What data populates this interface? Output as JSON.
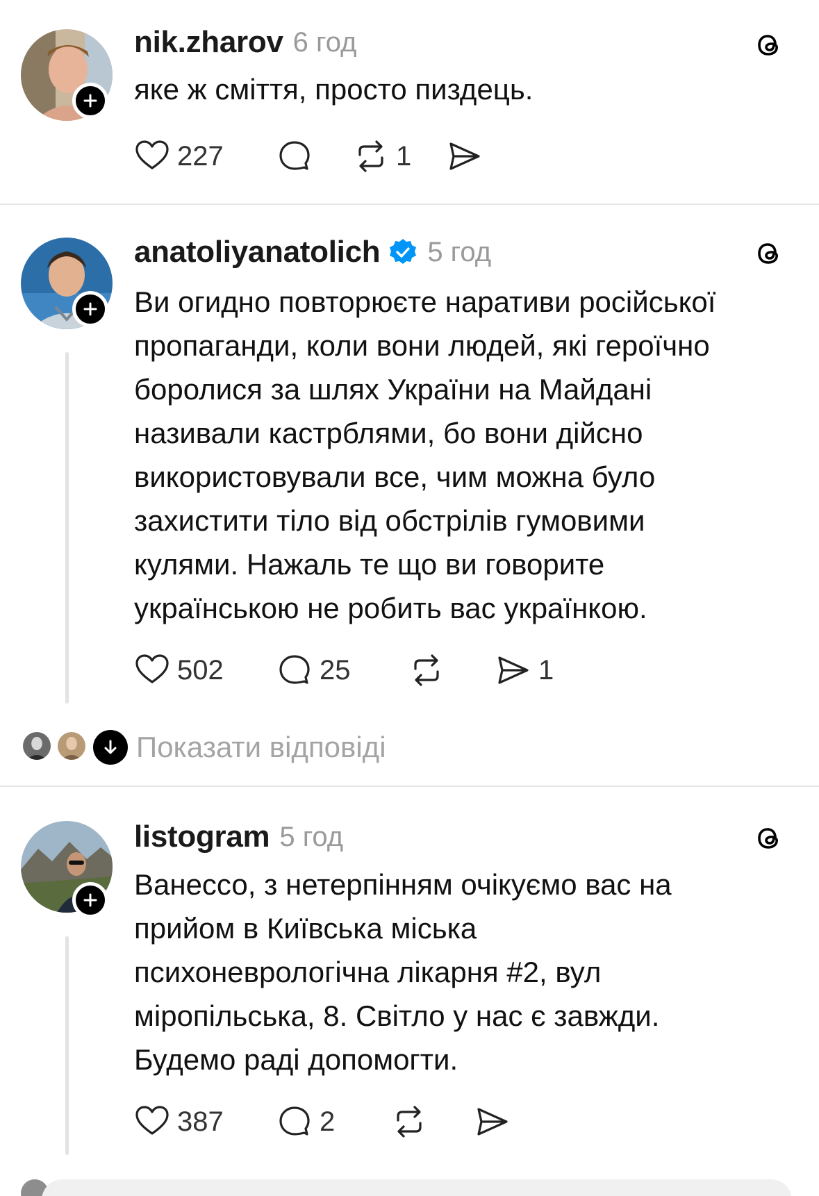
{
  "posts": [
    {
      "username": "nik.zharov",
      "verified": false,
      "time": "6 год",
      "text": "яке ж сміття, просто пиздець.",
      "likes": "227",
      "replies": "",
      "reposts": "1",
      "shares": ""
    },
    {
      "username": "anatoliyanatolich",
      "verified": true,
      "time": "5 год",
      "text": "Ви огидно повторюєте наративи російської\nпропаганди, коли вони людей, які героїчно\nборолися за шлях України на Майдані\nназивали кастрблями, бо вони дійсно\nвикористовували все, чим можна було\nзахистити тіло від обстрілів гумовими\nкулями. Нажаль те що ви говорите\nукраїнською не робить вас українкою.",
      "likes": "502",
      "replies": "25",
      "reposts": "",
      "shares": "1",
      "show_replies": "Показати відповіді"
    },
    {
      "username": "listogram",
      "verified": false,
      "time": "5 год",
      "text": "Ванессо, з нетерпінням очікуємо вас на\nприйом в Київська міська\nпсихоневрологічна лікарня #2, вул\nміропільська, 8. Світло у нас є завжди.\nБудемо раді допомогти.",
      "likes": "387",
      "replies": "2",
      "reposts": "",
      "shares": ""
    }
  ],
  "icons": {
    "like": "heart-icon",
    "reply": "comment-icon",
    "repost": "repost-icon",
    "share": "send-icon",
    "brand": "threads-logo-icon",
    "follow": "plus-icon",
    "verified": "verified-badge-icon",
    "expand": "arrow-down-icon"
  },
  "colors": {
    "verified": "#0095f6",
    "muted": "#9a9a9a",
    "divider": "#e6e6e6"
  }
}
